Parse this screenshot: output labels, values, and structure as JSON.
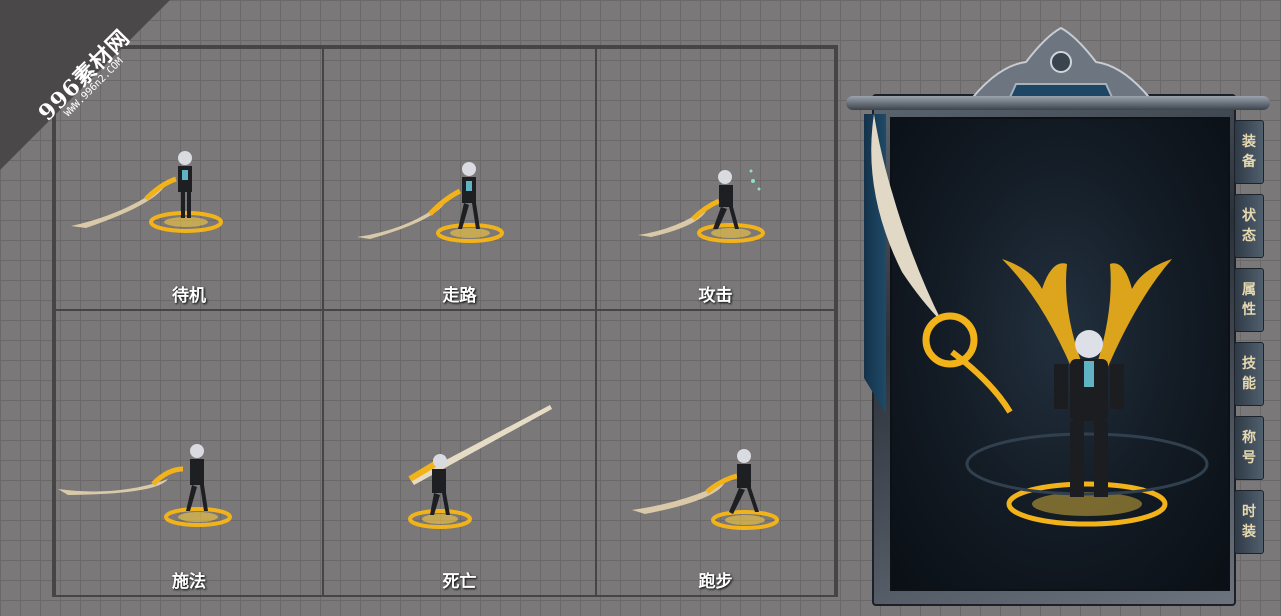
{
  "watermark": {
    "brand": "996素材网",
    "url": "WWW.996n2.COM"
  },
  "animations": [
    {
      "label": "待机"
    },
    {
      "label": "走路"
    },
    {
      "label": "攻击"
    },
    {
      "label": "施法"
    },
    {
      "label": "死亡"
    },
    {
      "label": "跑步"
    }
  ],
  "panel": {
    "tabs": [
      {
        "line1": "装",
        "line2": "备"
      },
      {
        "line1": "状",
        "line2": "态"
      },
      {
        "line1": "属",
        "line2": "性"
      },
      {
        "line1": "技",
        "line2": "能"
      },
      {
        "line1": "称",
        "line2": "号"
      },
      {
        "line1": "时",
        "line2": "装"
      }
    ]
  },
  "colors": {
    "gold": "#f2b21a",
    "blade": "#d9c9a8",
    "frame": "#5d6772"
  }
}
